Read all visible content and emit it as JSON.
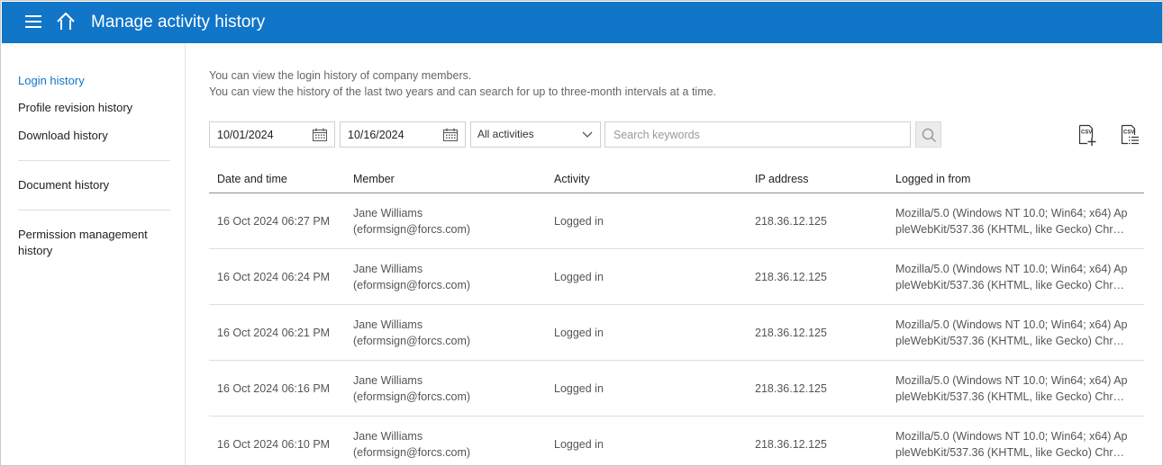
{
  "header": {
    "title": "Manage activity history",
    "bg_color": "#1175c8"
  },
  "sidebar": {
    "items": [
      {
        "label": "Login history",
        "active": true
      },
      {
        "label": "Profile revision history",
        "active": false
      },
      {
        "label": "Download history",
        "active": false
      },
      {
        "label": "Document history",
        "active": false
      },
      {
        "label": "Permission management history",
        "active": false
      }
    ]
  },
  "description": {
    "line1": "You can view the login history of company members.",
    "line2": "You can view the history of the last two years and can search for up to three-month intervals at a time."
  },
  "filters": {
    "start_date": "10/01/2024",
    "end_date": "10/16/2024",
    "activity_select": "All activities",
    "search_placeholder": "Search keywords",
    "search_value": "",
    "icons": {
      "calendar": "calendar-icon",
      "search": "search-icon",
      "csv_add": "csv-add-icon",
      "csv_list": "csv-list-icon"
    }
  },
  "table": {
    "headers": {
      "date": "Date and time",
      "member": "Member",
      "activity": "Activity",
      "ip": "IP address",
      "from": "Logged in from"
    },
    "rows": [
      {
        "date": "16 Oct 2024 06:27 PM",
        "member_name": "Jane Williams",
        "member_email": "(eformsign@forcs.com)",
        "activity": "Logged in",
        "ip": "218.36.12.125",
        "from_line1": "Mozilla/5.0 (Windows NT 10.0; Win64; x64) Ap",
        "from_line2": "pleWebKit/537.36 (KHTML, like Gecko) Chro…"
      },
      {
        "date": "16 Oct 2024 06:24 PM",
        "member_name": "Jane Williams",
        "member_email": "(eformsign@forcs.com)",
        "activity": "Logged in",
        "ip": "218.36.12.125",
        "from_line1": "Mozilla/5.0 (Windows NT 10.0; Win64; x64) Ap",
        "from_line2": "pleWebKit/537.36 (KHTML, like Gecko) Chro…"
      },
      {
        "date": "16 Oct 2024 06:21 PM",
        "member_name": "Jane Williams",
        "member_email": "(eformsign@forcs.com)",
        "activity": "Logged in",
        "ip": "218.36.12.125",
        "from_line1": "Mozilla/5.0 (Windows NT 10.0; Win64; x64) Ap",
        "from_line2": "pleWebKit/537.36 (KHTML, like Gecko) Chro…"
      },
      {
        "date": "16 Oct 2024 06:16 PM",
        "member_name": "Jane Williams",
        "member_email": "(eformsign@forcs.com)",
        "activity": "Logged in",
        "ip": "218.36.12.125",
        "from_line1": "Mozilla/5.0 (Windows NT 10.0; Win64; x64) Ap",
        "from_line2": "pleWebKit/537.36 (KHTML, like Gecko) Chro…"
      },
      {
        "date": "16 Oct 2024 06:10 PM",
        "member_name": "Jane Williams",
        "member_email": "(eformsign@forcs.com)",
        "activity": "Logged in",
        "ip": "218.36.12.125",
        "from_line1": "Mozilla/5.0 (Windows NT 10.0; Win64; x64) Ap",
        "from_line2": "pleWebKit/537.36 (KHTML, like Gecko) Chro…"
      }
    ]
  }
}
